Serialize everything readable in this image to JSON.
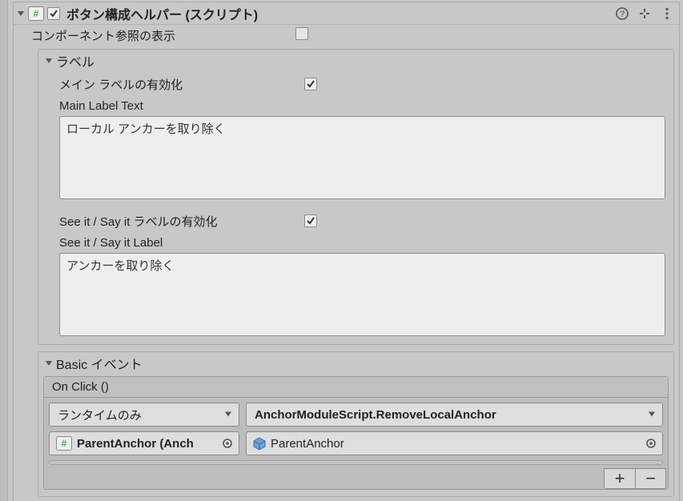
{
  "header": {
    "title": "ボタン構成ヘルパー (スクリプト)"
  },
  "props": {
    "show_component_refs_label": "コンポーネント参照の表示"
  },
  "label_section": {
    "title": "ラベル",
    "enable_main_label": "メイン ラベルの有効化",
    "main_label_text_label": "Main Label Text",
    "main_label_text_value": "ローカル アンカーを取り除く",
    "enable_seeit_label": "See it / Say it ラベルの有効化",
    "seeit_label_label": "See it / Say it Label",
    "seeit_label_value": "アンカーを取り除く"
  },
  "events": {
    "section_title": "Basic イベント",
    "onclick_title": "On Click ()",
    "runtime_mode": "ランタイムのみ",
    "method": "AnchorModuleScript.RemoveLocalAnchor",
    "object_ref": "ParentAnchor (Anch",
    "argument_ref": "ParentAnchor"
  }
}
